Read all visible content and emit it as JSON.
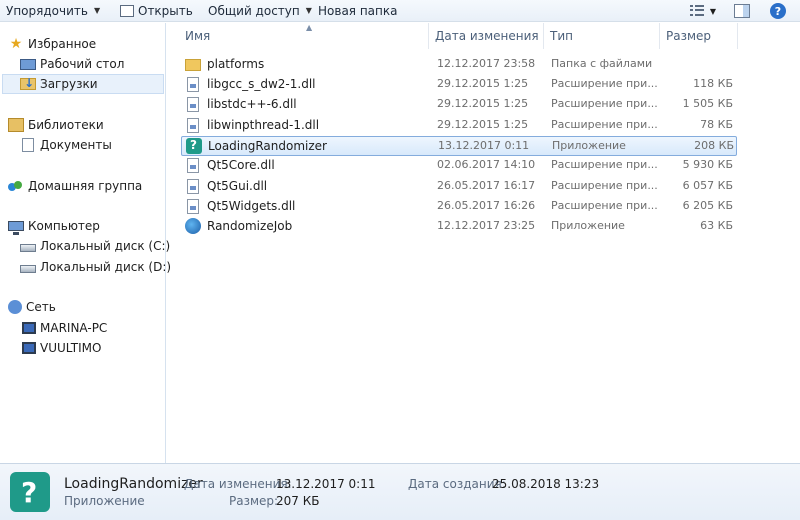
{
  "toolbar": {
    "organize_label": "Упорядочить",
    "open_label": "Открыть",
    "share_label": "Общий доступ",
    "new_folder_label": "Новая папка"
  },
  "sidebar": {
    "favorites": "Избранное",
    "desktop": "Рабочий стол",
    "downloads": "Загрузки",
    "libraries": "Библиотеки",
    "documents": "Документы",
    "homegroup": "Домашняя группа",
    "computer": "Компьютер",
    "disk_c": "Локальный диск (C:)",
    "disk_d": "Локальный диск (D:)",
    "network": "Сеть",
    "pc1": "MARINA-PC",
    "pc2": "VUULTIMO"
  },
  "columns": {
    "name": "Имя",
    "date": "Дата изменения",
    "type": "Тип",
    "size": "Размер"
  },
  "files": [
    {
      "name": "platforms",
      "date": "12.12.2017 23:58",
      "type": "Папка с файлами",
      "size": ""
    },
    {
      "name": "libgcc_s_dw2-1.dll",
      "date": "29.12.2015 1:25",
      "type": "Расширение при...",
      "size": "118 КБ"
    },
    {
      "name": "libstdc++-6.dll",
      "date": "29.12.2015 1:25",
      "type": "Расширение при...",
      "size": "1 505 КБ"
    },
    {
      "name": "libwinpthread-1.dll",
      "date": "29.12.2015 1:25",
      "type": "Расширение при...",
      "size": "78 КБ"
    },
    {
      "name": "LoadingRandomizer",
      "date": "13.12.2017 0:11",
      "type": "Приложение",
      "size": "208 КБ"
    },
    {
      "name": "Qt5Core.dll",
      "date": "02.06.2017 14:10",
      "type": "Расширение при...",
      "size": "5 930 КБ"
    },
    {
      "name": "Qt5Gui.dll",
      "date": "26.05.2017 16:17",
      "type": "Расширение при...",
      "size": "6 057 КБ"
    },
    {
      "name": "Qt5Widgets.dll",
      "date": "26.05.2017 16:26",
      "type": "Расширение при...",
      "size": "6 205 КБ"
    },
    {
      "name": "RandomizeJob",
      "date": "12.12.2017 23:25",
      "type": "Приложение",
      "size": "63 КБ"
    }
  ],
  "details": {
    "name": "LoadingRandomizer",
    "kind": "Приложение",
    "modified_label": "Дата изменения:",
    "modified_value": "13.12.2017 0:11",
    "created_label": "Дата создания:",
    "created_value": "25.08.2018 13:23",
    "size_label": "Размер:",
    "size_value": "207 КБ"
  }
}
